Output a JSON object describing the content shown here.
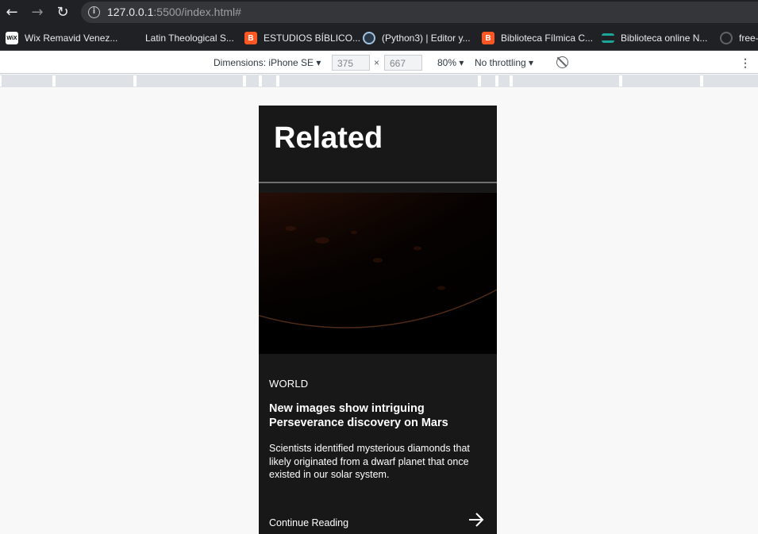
{
  "browser": {
    "url_main": "127.0.0.1",
    "url_rest": ":5500/index.html#"
  },
  "bookmarks": [
    {
      "label": "Wix Remavid Venez...",
      "icon": "wix-icon"
    },
    {
      "label": "Latin Theological S...",
      "icon": "blank-icon"
    },
    {
      "label": "ESTUDIOS BÍBLICO...",
      "icon": "blogger-icon"
    },
    {
      "label": "(Python3) | Editor y...",
      "icon": "python-icon"
    },
    {
      "label": "Biblioteca Fílmica C...",
      "icon": "blogger-icon"
    },
    {
      "label": "Biblioteca online N...",
      "icon": "stack-icon"
    },
    {
      "label": "free-",
      "icon": "github-icon"
    }
  ],
  "devtools": {
    "dimensions_label": "Dimensions: iPhone SE",
    "width": "375",
    "height": "667",
    "times": "×",
    "zoom": "80%",
    "throttling": "No throttling"
  },
  "page": {
    "section_title": "Related",
    "article": {
      "category": "WORLD",
      "headline": "New images show intriguing Perseverance discovery on Mars",
      "excerpt": "Scientists identified mysterious diamonds that likely originated from a dwarf planet that once existed in our solar system.",
      "cta": "Continue Reading"
    }
  }
}
